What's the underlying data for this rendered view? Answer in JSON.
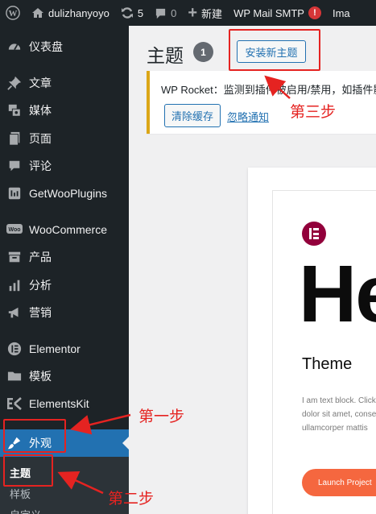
{
  "admin_bar": {
    "site_name": "dulizhanyoyo",
    "updates_count": "5",
    "comments_count": "0",
    "new_label": "新建",
    "smtp_label": "WP Mail SMTP",
    "smtp_badge": "!",
    "trailing_label": "Ima"
  },
  "sidebar": {
    "items": [
      {
        "label": "仪表盘",
        "icon": "dashboard-icon"
      },
      {
        "label": "文章",
        "icon": "pin-icon"
      },
      {
        "label": "媒体",
        "icon": "media-icon"
      },
      {
        "label": "页面",
        "icon": "page-icon"
      },
      {
        "label": "评论",
        "icon": "comment-icon"
      },
      {
        "label": "GetWooPlugins",
        "icon": "plugin-icon"
      },
      {
        "label": "WooCommerce",
        "icon": "woo-icon"
      },
      {
        "label": "产品",
        "icon": "product-icon"
      },
      {
        "label": "分析",
        "icon": "chart-icon"
      },
      {
        "label": "营销",
        "icon": "megaphone-icon"
      },
      {
        "label": "Elementor",
        "icon": "elementor-icon"
      },
      {
        "label": "模板",
        "icon": "folder-icon"
      },
      {
        "label": "ElementsKit",
        "icon": "ek-icon"
      },
      {
        "label": "外观",
        "icon": "brush-icon"
      }
    ],
    "submenu": [
      "主题",
      "样板",
      "自定义"
    ]
  },
  "main": {
    "title": "主题",
    "theme_count": "1",
    "add_new_label": "安装新主题"
  },
  "notice": {
    "text": "WP Rocket：监测到插件被启用/禁用，如插件影响",
    "clear_cache_label": "清除缓存",
    "dismiss_label": "忽略通知"
  },
  "theme_preview": {
    "hero": "He",
    "title": "Theme",
    "body_lines": [
      "I am text block. Click",
      "dolor sit amet, conse",
      "ullamcorper mattis"
    ],
    "cta": "Launch Project"
  },
  "annotations": {
    "step1": "第一步",
    "step2": "第二步",
    "step3": "第三步"
  },
  "colors": {
    "admin_dark": "#1d2327",
    "wp_blue": "#2271b1",
    "annotation_red": "#e52321",
    "notice_yellow": "#dba617",
    "elementor": "#92003b",
    "cta_orange": "#f5673f"
  }
}
